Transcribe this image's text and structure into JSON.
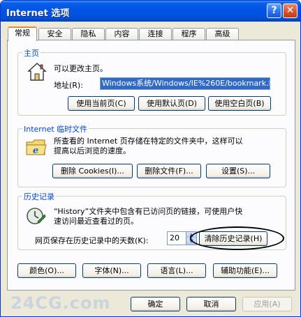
{
  "window": {
    "title": "Internet 选项"
  },
  "titlebar": {
    "help_label": "?",
    "close_label": "✕"
  },
  "tabs": [
    {
      "label": "常规"
    },
    {
      "label": "安全"
    },
    {
      "label": "隐私"
    },
    {
      "label": "内容"
    },
    {
      "label": "连接"
    },
    {
      "label": "程序"
    },
    {
      "label": "高级"
    }
  ],
  "home": {
    "legend": "主页",
    "desc": "可以更改主页。",
    "address_label": "地址(R):",
    "address_value": "Windows系统/Windows/IE%260E/bookmark.htm",
    "use_current": "使用当前页(C)",
    "use_default": "使用默认页(D)",
    "use_blank": "使用空白页(B)"
  },
  "temp_files": {
    "legend": "Internet 临时文件",
    "desc_line1": "所查看的 Internet 页存储在特定的文件夹中，这样可以",
    "desc_line2": "提高以后浏览的速度。",
    "delete_cookies": "删除 Cookies(I)...",
    "delete_files": "删除文件(F)...",
    "settings": "设置(S)..."
  },
  "history": {
    "legend": "历史记录",
    "desc_line1": "“History”文件夹中包含有已访问页的链接，可使用户快",
    "desc_line2": "速访问最近查看过的页。",
    "days_label": "网页保存在历史记录中的天数(K):",
    "days_value": "20",
    "clear_history": "清除历史记录(H)"
  },
  "bottom_buttons": {
    "colors": "颜色(O)...",
    "fonts": "字体(N)...",
    "languages": "语言(L)...",
    "accessibility": "辅助功能(E)..."
  },
  "dialog_buttons": {
    "ok": "确定",
    "cancel": "取消",
    "apply": "应用(A)"
  },
  "watermark": "24CG.com"
}
